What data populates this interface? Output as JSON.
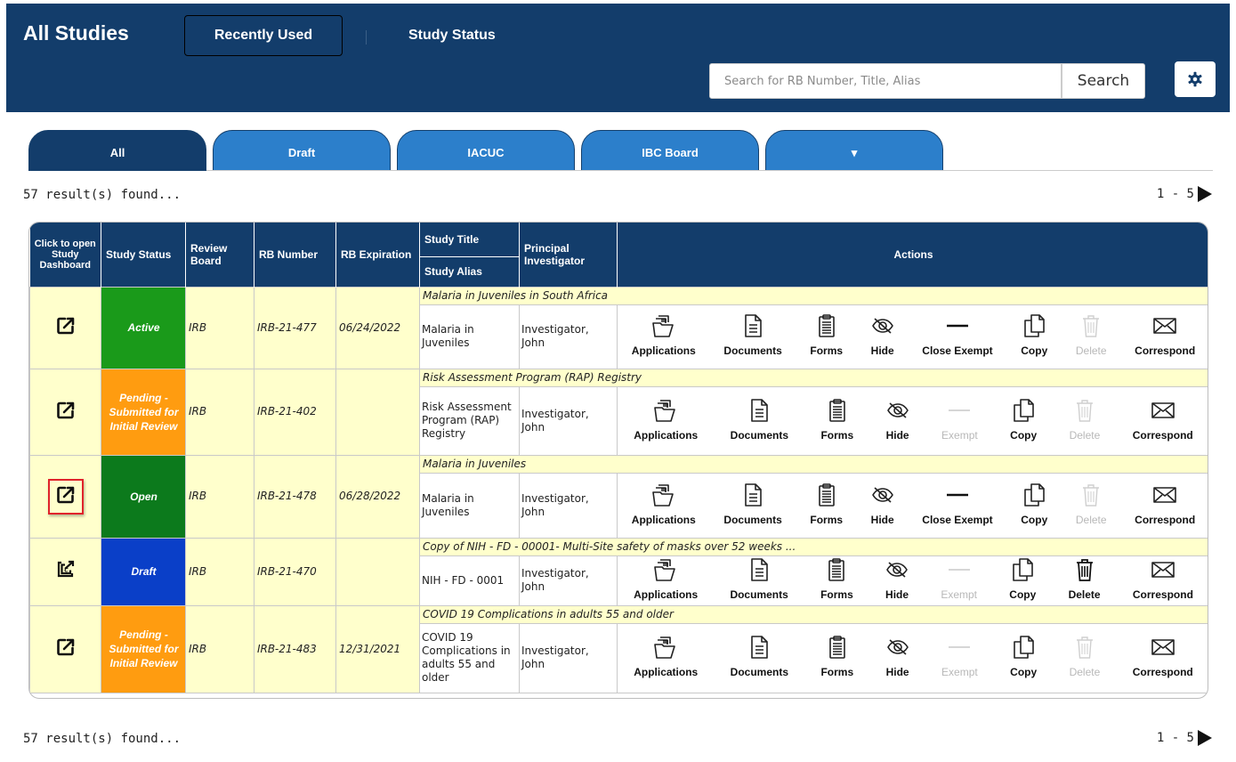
{
  "header": {
    "title": "All Studies",
    "recently_used": "Recently Used",
    "study_status": "Study Status",
    "search_placeholder": "Search for RB Number, Title, Alias",
    "search_button": "Search"
  },
  "tabs": [
    {
      "label": "All",
      "active": true
    },
    {
      "label": "Draft",
      "active": false
    },
    {
      "label": "IACUC",
      "active": false
    },
    {
      "label": "IBC Board",
      "active": false
    },
    {
      "label": "▾",
      "active": false
    }
  ],
  "results": {
    "count_text": "57 result(s) found...",
    "pager_text": "1 - 5"
  },
  "table": {
    "headers": {
      "open": "Click to open Study Dashboard",
      "status": "Study Status",
      "board": "Review Board",
      "rb": "RB Number",
      "expiration": "RB Expiration",
      "title": "Study Title",
      "alias": "Study Alias",
      "pi": "Principal Investigator",
      "actions": "Actions"
    },
    "action_labels": {
      "applications": "Applications",
      "documents": "Documents",
      "forms": "Forms",
      "hide": "Hide",
      "close_exempt": "Close Exempt",
      "exempt": "Exempt",
      "copy": "Copy",
      "delete": "Delete",
      "correspond": "Correspond"
    },
    "rows": [
      {
        "title": "Malaria in Juveniles in South Africa",
        "status": "Active",
        "status_color": "#1a9a1a",
        "board": "IRB",
        "rb": "IRB-21-477",
        "expiration": "06/24/2022",
        "alias": "Malaria in Juveniles",
        "pi": "Investigator, John",
        "exempt_label": "Close Exempt",
        "exempt_enabled": true,
        "delete_enabled": false,
        "open_icon": "open-dashboard-icon"
      },
      {
        "title": "Risk Assessment Program (RAP) Registry",
        "status": "Pending - Submitted for Initial Review",
        "status_color": "#ff9c10",
        "board": "IRB",
        "rb": "IRB-21-402",
        "expiration": "",
        "alias": "Risk Assessment Program (RAP) Registry",
        "pi": "Investigator, John",
        "exempt_label": "Exempt",
        "exempt_enabled": false,
        "delete_enabled": false,
        "open_icon": "open-dashboard-icon"
      },
      {
        "title": "Malaria in Juveniles",
        "status": "Open",
        "status_color": "#0c7a1c",
        "board": "IRB",
        "rb": "IRB-21-478",
        "expiration": "06/28/2022",
        "alias": "Malaria in Juveniles",
        "pi": "Investigator, John",
        "exempt_label": "Close Exempt",
        "exempt_enabled": true,
        "delete_enabled": false,
        "open_icon": "open-dashboard-icon",
        "selected": true
      },
      {
        "title": "Copy of NIH - FD - 00001- Multi-Site safety of masks over 52 weeks ...",
        "status": "Draft",
        "status_color": "#0a3fc8",
        "board": "IRB",
        "rb": "IRB-21-470",
        "expiration": "",
        "alias": "NIH - FD - 0001",
        "pi": "Investigator, John",
        "exempt_label": "Exempt",
        "exempt_enabled": false,
        "delete_enabled": true,
        "open_icon": "open-copy-dashboard-icon"
      },
      {
        "title": "COVID 19 Complications in adults 55 and older",
        "status": "Pending - Submitted for Initial Review",
        "status_color": "#ff9c10",
        "board": "IRB",
        "rb": "IRB-21-483",
        "expiration": "12/31/2021",
        "alias": "COVID 19 Complications in adults 55 and older",
        "pi": "Investigator, John",
        "exempt_label": "Exempt",
        "exempt_enabled": false,
        "delete_enabled": false,
        "open_icon": "open-dashboard-icon"
      }
    ]
  },
  "footer": {
    "count_text": "57 result(s) found...",
    "pager_text": "1 - 5"
  }
}
